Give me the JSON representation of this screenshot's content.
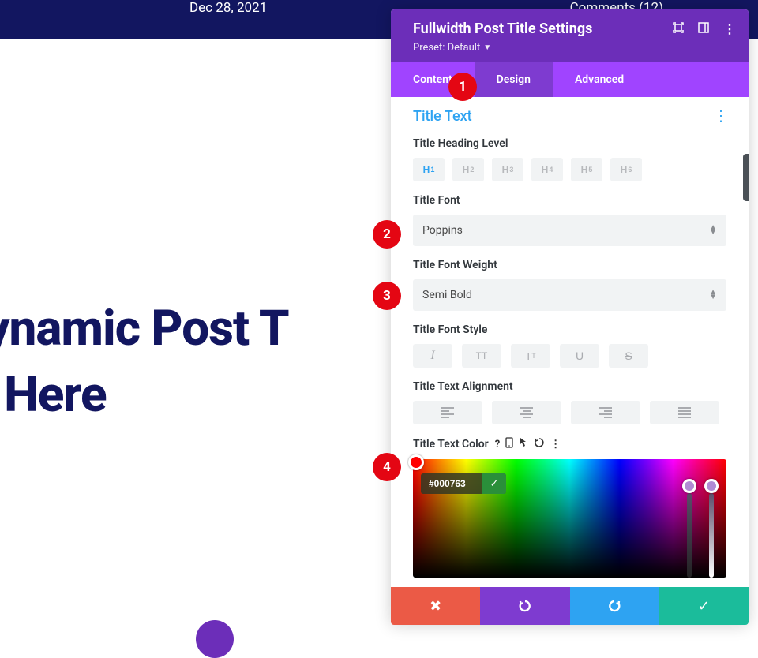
{
  "header": {
    "date": "Dec 28, 2021",
    "comments": "Comments (12)"
  },
  "preview": {
    "title_line1": ")ynamic Post T",
    "title_line2": "y Here"
  },
  "panel": {
    "title": "Fullwidth Post Title Settings",
    "preset": "Preset: Default",
    "tabs": {
      "content": "Content",
      "design": "Design",
      "advanced": "Advanced"
    }
  },
  "section": {
    "title": "Title Text"
  },
  "fields": {
    "heading_level": "Title Heading Level",
    "font": "Title Font",
    "font_value": "Poppins",
    "weight": "Title Font Weight",
    "weight_value": "Semi Bold",
    "style": "Title Font Style",
    "align": "Title Text Alignment",
    "color": "Title Text Color",
    "color_hex": "#000763"
  },
  "heading_buttons": [
    "H1",
    "H2",
    "H3",
    "H4",
    "H5",
    "H6"
  ],
  "annotations": {
    "a1": "1",
    "a2": "2",
    "a3": "3",
    "a4": "4"
  }
}
